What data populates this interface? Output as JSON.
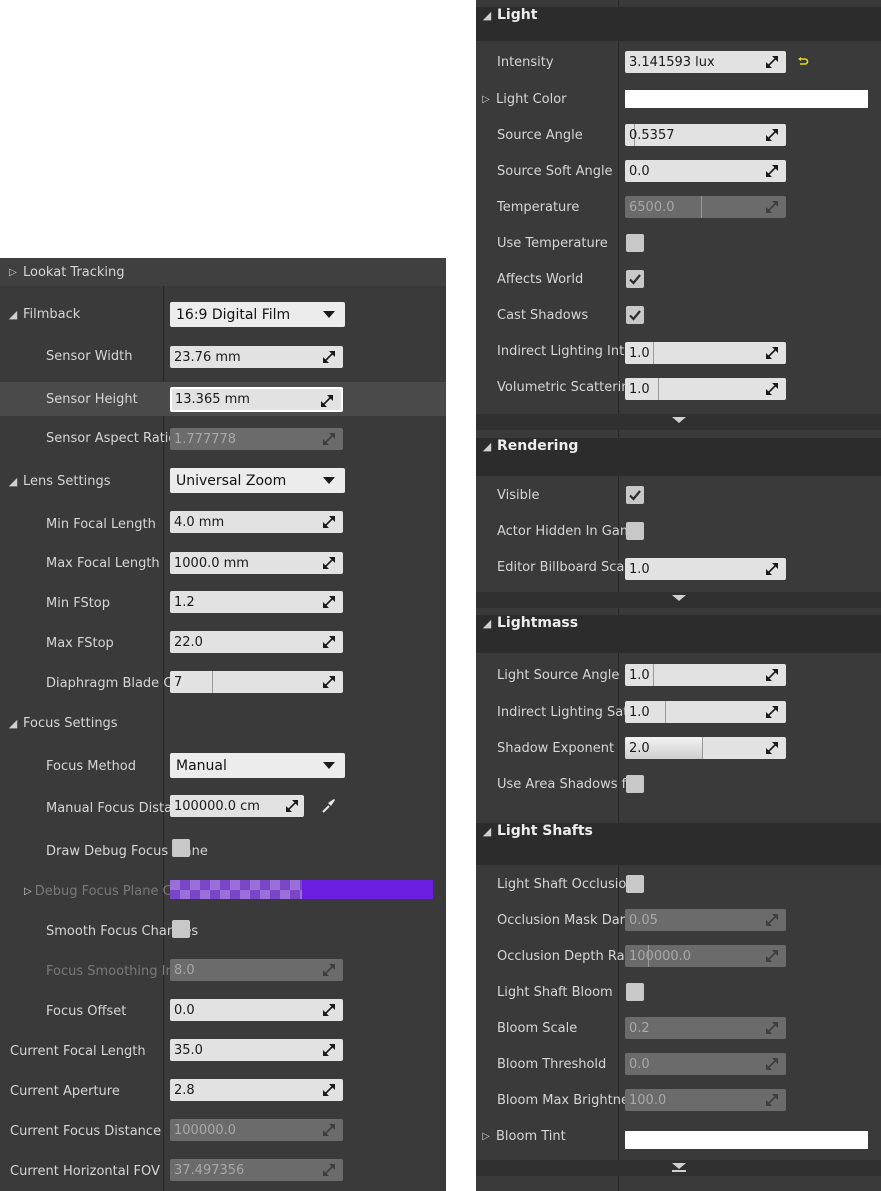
{
  "left": {
    "lookat_tracking": "Lookat Tracking",
    "filmback": {
      "label": "Filmback",
      "value": "16:9 Digital Film"
    },
    "sensor_width": {
      "label": "Sensor Width",
      "value": "23.76 mm"
    },
    "sensor_height": {
      "label": "Sensor Height",
      "value": "13.365 mm"
    },
    "sensor_aspect": {
      "label": "Sensor Aspect Ratio",
      "value": "1.777778"
    },
    "lens_settings": {
      "label": "Lens Settings",
      "value": "Universal Zoom"
    },
    "min_focal": {
      "label": "Min Focal Length",
      "value": "4.0 mm"
    },
    "max_focal": {
      "label": "Max Focal Length",
      "value": "1000.0 mm"
    },
    "min_fstop": {
      "label": "Min FStop",
      "value": "1.2"
    },
    "max_fstop": {
      "label": "Max FStop",
      "value": "22.0"
    },
    "diaphragm": {
      "label": "Diaphragm Blade Count",
      "value": "7"
    },
    "focus_settings": "Focus Settings",
    "focus_method": {
      "label": "Focus Method",
      "value": "Manual"
    },
    "manual_focus": {
      "label": "Manual Focus Distance",
      "value": "100000.0 cm"
    },
    "draw_debug": {
      "label": "Draw Debug Focus Plane",
      "checked": false
    },
    "debug_focus": {
      "label": "Debug Focus Plane Color",
      "color": "#6a1ee0"
    },
    "smooth_focus": {
      "label": "Smooth Focus Changes",
      "checked": false
    },
    "focus_smoothing": {
      "label": "Focus Smoothing Interp Speed",
      "value": "8.0"
    },
    "focus_offset": {
      "label": "Focus Offset",
      "value": "0.0"
    },
    "current_focal": {
      "label": "Current Focal Length",
      "value": "35.0"
    },
    "current_aperture": {
      "label": "Current Aperture",
      "value": "2.8"
    },
    "current_focus_distance": {
      "label": "Current Focus Distance",
      "value": "100000.0"
    },
    "current_hfov": {
      "label": "Current Horizontal FOV",
      "value": "37.497356"
    }
  },
  "right": {
    "light": {
      "title": "Light",
      "intensity": {
        "label": "Intensity",
        "value": "3.141593 lux"
      },
      "light_color": {
        "label": "Light Color",
        "color": "#ffffff"
      },
      "source_angle": {
        "label": "Source Angle",
        "value": "0.5357"
      },
      "source_soft_angle": {
        "label": "Source Soft Angle",
        "value": "0.0"
      },
      "temperature": {
        "label": "Temperature",
        "value": "6500.0"
      },
      "use_temperature": {
        "label": "Use Temperature",
        "checked": false
      },
      "affects_world": {
        "label": "Affects World",
        "checked": true
      },
      "cast_shadows": {
        "label": "Cast Shadows",
        "checked": true
      },
      "indirect_lighting": {
        "label": "Indirect Lighting Intensity",
        "value": "1.0"
      },
      "volumetric": {
        "label": "Volumetric Scattering Intensity",
        "value": "1.0"
      }
    },
    "rendering": {
      "title": "Rendering",
      "visible": {
        "label": "Visible",
        "checked": true
      },
      "actor_hidden": {
        "label": "Actor Hidden In Game",
        "checked": false
      },
      "editor_billboard": {
        "label": "Editor Billboard Scale",
        "value": "1.0"
      }
    },
    "lightmass": {
      "title": "Lightmass",
      "light_source_angle": {
        "label": "Light Source Angle",
        "value": "1.0"
      },
      "indirect_lighting": {
        "label": "Indirect Lighting Saturation",
        "value": "1.0"
      },
      "shadow_exponent": {
        "label": "Shadow Exponent",
        "value": "2.0"
      },
      "use_area_shadows": {
        "label": "Use Area Shadows for Stationary Light",
        "checked": false
      }
    },
    "light_shafts": {
      "title": "Light Shafts",
      "light_shaft_occlusion": {
        "label": "Light Shaft Occlusion",
        "checked": false
      },
      "occlusion_mask": {
        "label": "Occlusion Mask Darkness",
        "value": "0.05"
      },
      "occlusion_depth": {
        "label": "Occlusion Depth Range",
        "value": "100000.0"
      },
      "light_shaft_bloom": {
        "label": "Light Shaft Bloom",
        "checked": false
      },
      "bloom_scale": {
        "label": "Bloom Scale",
        "value": "0.2"
      },
      "bloom_threshold": {
        "label": "Bloom Threshold",
        "value": "0.0"
      },
      "bloom_max_brightness": {
        "label": "Bloom Max Brightness",
        "value": "100.0"
      },
      "bloom_tint": {
        "label": "Bloom Tint",
        "color": "#ffffff"
      }
    }
  }
}
